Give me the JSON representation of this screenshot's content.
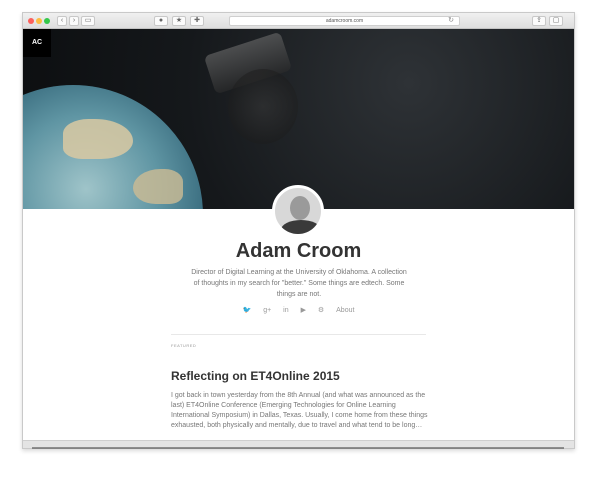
{
  "browser": {
    "url": "adamcroom.com",
    "buttons": {
      "back": "‹",
      "forward": "›",
      "sidebar": "▭",
      "share": "⇪",
      "tabs": "▢"
    },
    "reload_icon": "↻"
  },
  "site": {
    "logo": "AC",
    "name": "Adam Croom",
    "bio": "Director of Digital Learning at the University of Oklahoma. A collection of thoughts in my search for \"better.\" Some things are edtech. Some things are not.",
    "social": {
      "twitter": "🐦",
      "google_plus": "g+",
      "linkedin": "in",
      "youtube": "▶",
      "github": "⚙",
      "about": "About"
    }
  },
  "post": {
    "label": "FEATURED",
    "title": "Reflecting on ET4Online 2015",
    "excerpt": "I got back in town yesterday from the 8th Annual (and what was announced as the last) ET4Online Conference (Emerging Technologies for Online Learning International Symposium) in Dallas, Texas. Usually, I come home from these things exhausted, both physically and mentally, due to travel and what tend to be long…"
  }
}
